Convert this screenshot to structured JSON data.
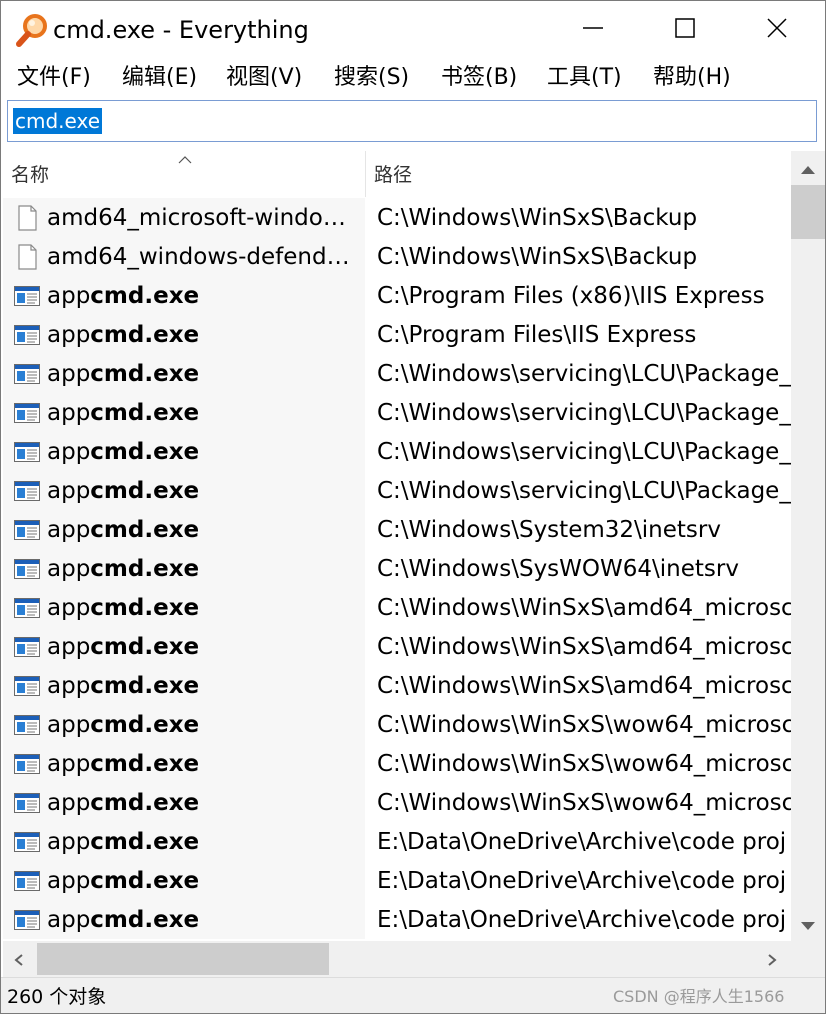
{
  "window": {
    "title": "cmd.exe - Everything",
    "app_icon": "everything-magnifier-icon",
    "accent_color": "#0078d7"
  },
  "menu": [
    {
      "label": "文件(F)"
    },
    {
      "label": "编辑(E)"
    },
    {
      "label": "视图(V)"
    },
    {
      "label": "搜索(S)"
    },
    {
      "label": "书签(B)"
    },
    {
      "label": "工具(T)"
    },
    {
      "label": "帮助(H)"
    }
  ],
  "search": {
    "value": "cmd.exe"
  },
  "columns": {
    "name": "名称",
    "path": "路径",
    "sorted_by": "name",
    "sort_direction": "ascending"
  },
  "rows": [
    {
      "icon": "generic-file-icon",
      "name_pre": "amd64_microsoft-window...",
      "name_bold": "",
      "name_post": "",
      "path": "C:\\Windows\\WinSxS\\Backup"
    },
    {
      "icon": "generic-file-icon",
      "name_pre": "amd64_windows-defende...",
      "name_bold": "",
      "name_post": "",
      "path": "C:\\Windows\\WinSxS\\Backup"
    },
    {
      "icon": "exe-window-icon",
      "name_pre": "app",
      "name_bold": "cmd.exe",
      "name_post": "",
      "path": "C:\\Program Files (x86)\\IIS Express"
    },
    {
      "icon": "exe-window-icon",
      "name_pre": "app",
      "name_bold": "cmd.exe",
      "name_post": "",
      "path": "C:\\Program Files\\IIS Express"
    },
    {
      "icon": "exe-window-icon",
      "name_pre": "app",
      "name_bold": "cmd.exe",
      "name_post": "",
      "path": "C:\\Windows\\servicing\\LCU\\Package_"
    },
    {
      "icon": "exe-window-icon",
      "name_pre": "app",
      "name_bold": "cmd.exe",
      "name_post": "",
      "path": "C:\\Windows\\servicing\\LCU\\Package_"
    },
    {
      "icon": "exe-window-icon",
      "name_pre": "app",
      "name_bold": "cmd.exe",
      "name_post": "",
      "path": "C:\\Windows\\servicing\\LCU\\Package_"
    },
    {
      "icon": "exe-window-icon",
      "name_pre": "app",
      "name_bold": "cmd.exe",
      "name_post": "",
      "path": "C:\\Windows\\servicing\\LCU\\Package_"
    },
    {
      "icon": "exe-window-icon",
      "name_pre": "app",
      "name_bold": "cmd.exe",
      "name_post": "",
      "path": "C:\\Windows\\System32\\inetsrv"
    },
    {
      "icon": "exe-window-icon",
      "name_pre": "app",
      "name_bold": "cmd.exe",
      "name_post": "",
      "path": "C:\\Windows\\SysWOW64\\inetsrv"
    },
    {
      "icon": "exe-window-icon",
      "name_pre": "app",
      "name_bold": "cmd.exe",
      "name_post": "",
      "path": "C:\\Windows\\WinSxS\\amd64_microsc"
    },
    {
      "icon": "exe-window-icon",
      "name_pre": "app",
      "name_bold": "cmd.exe",
      "name_post": "",
      "path": "C:\\Windows\\WinSxS\\amd64_microsc"
    },
    {
      "icon": "exe-window-icon",
      "name_pre": "app",
      "name_bold": "cmd.exe",
      "name_post": "",
      "path": "C:\\Windows\\WinSxS\\amd64_microsc"
    },
    {
      "icon": "exe-window-icon",
      "name_pre": "app",
      "name_bold": "cmd.exe",
      "name_post": "",
      "path": "C:\\Windows\\WinSxS\\wow64_microsc"
    },
    {
      "icon": "exe-window-icon",
      "name_pre": "app",
      "name_bold": "cmd.exe",
      "name_post": "",
      "path": "C:\\Windows\\WinSxS\\wow64_microsc"
    },
    {
      "icon": "exe-window-icon",
      "name_pre": "app",
      "name_bold": "cmd.exe",
      "name_post": "",
      "path": "C:\\Windows\\WinSxS\\wow64_microsc"
    },
    {
      "icon": "exe-window-icon",
      "name_pre": "app",
      "name_bold": "cmd.exe",
      "name_post": "",
      "path": "E:\\Data\\OneDrive\\Archive\\code proj"
    },
    {
      "icon": "exe-window-icon",
      "name_pre": "app",
      "name_bold": "cmd.exe",
      "name_post": "",
      "path": "E:\\Data\\OneDrive\\Archive\\code proj"
    },
    {
      "icon": "exe-window-icon",
      "name_pre": "app",
      "name_bold": "cmd.exe",
      "name_post": "",
      "path": "E:\\Data\\OneDrive\\Archive\\code proj"
    }
  ],
  "status": {
    "count_text": "260 个对象"
  },
  "watermark": {
    "text": "CSDN @程序人生1566"
  }
}
